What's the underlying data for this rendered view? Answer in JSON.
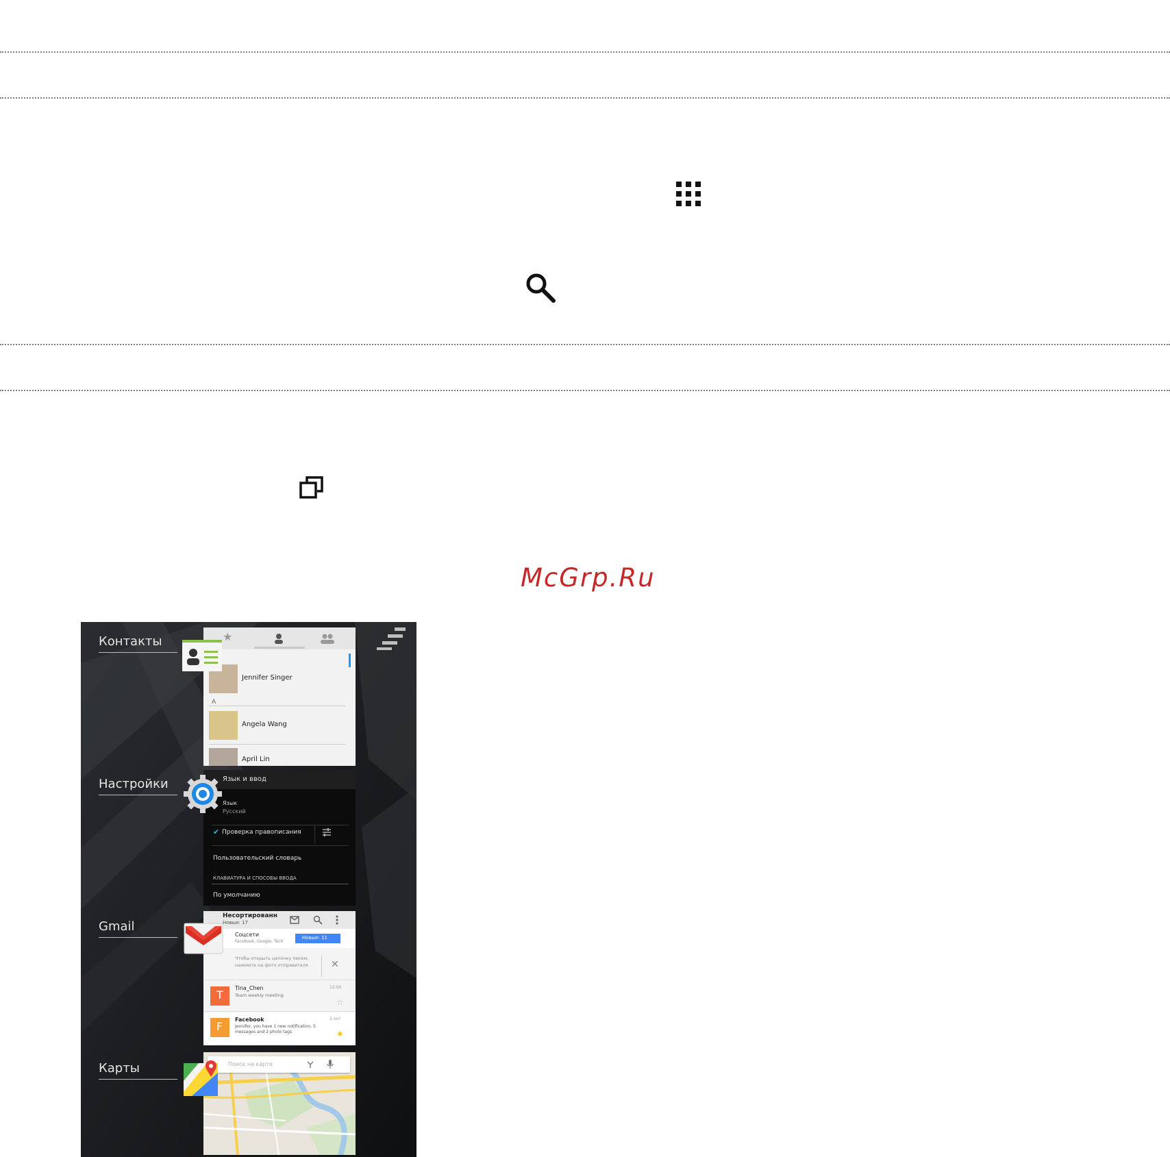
{
  "watermark": "McGrp.Ru",
  "icons": {
    "apps": "apps-grid-icon",
    "search": "search-icon",
    "recent_apps": "recent-apps-icon"
  },
  "recent_apps": {
    "contacts": {
      "label": "Контакты",
      "list": [
        {
          "name": "Jennifer Singer"
        },
        {
          "name": "Angela Wang"
        },
        {
          "name": "April Lin"
        }
      ],
      "section_letter": "A"
    },
    "settings": {
      "label": "Настройки",
      "header": "Язык и ввод",
      "item1_title": "Язык",
      "item1_sub": "Русский",
      "spell_check": "Проверка правописания",
      "user_dict": "Пользовательский словарь",
      "keyboards_section": "КЛАВИАТУРА И СПОСОБЫ ВВОДА",
      "default": "По умолчанию"
    },
    "gmail": {
      "label": "Gmail",
      "folder": "Несортированн",
      "folder_sub": "Новые: 17",
      "social": "Соцсети",
      "social_sub": "Facebook, Google, Tech",
      "new_badge": "Новые: 11",
      "tip": "Чтобы открыть цепочку писем, нажмите на фото отправителя",
      "mails": [
        {
          "initial": "T",
          "from": "Tina_Chen",
          "subject": "Team weekly meeting",
          "time": "12:00"
        },
        {
          "initial": "F",
          "from": "Facebook",
          "subject": "Jennifer, you have 1 new notification, 5 messages and 2 photo tags",
          "time": "2 окт"
        }
      ]
    },
    "maps": {
      "label": "Карты",
      "search_placeholder": "Поиск на карте"
    }
  },
  "colors": {
    "watermark": "#c62828",
    "gmail_blue": "#4285f4",
    "tina_avatar": "#f26b3a",
    "facebook_avatar": "#f49b31"
  }
}
